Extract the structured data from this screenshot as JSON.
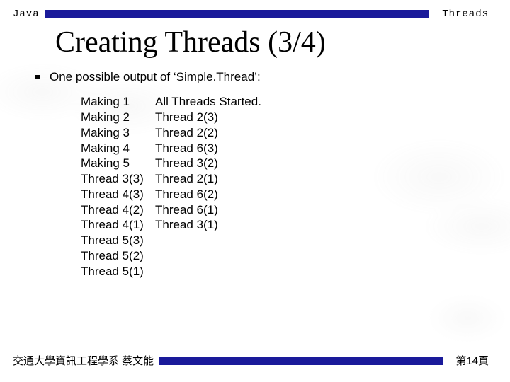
{
  "header": {
    "left": "Java",
    "right": "Threads"
  },
  "title": "Creating Threads (3/4)",
  "bullet": "One possible output of ‘Simple.Thread’:",
  "output": {
    "col1": [
      "Making 1",
      "Making 2",
      "Making 3",
      "Making 4",
      "Making 5",
      "Thread 3(3)",
      "Thread 4(3)",
      "Thread 4(2)",
      "Thread 4(1)",
      "Thread 5(3)",
      "Thread 5(2)",
      "Thread 5(1)"
    ],
    "col2": [
      "All Threads Started.",
      "Thread 2(3)",
      "Thread 2(2)",
      "Thread 6(3)",
      "Thread 3(2)",
      "Thread 2(1)",
      "Thread 6(2)",
      "Thread 6(1)",
      "Thread 3(1)"
    ]
  },
  "footer": {
    "left": "交通大學資訊工程學系  蔡文能",
    "right": "第14頁"
  }
}
